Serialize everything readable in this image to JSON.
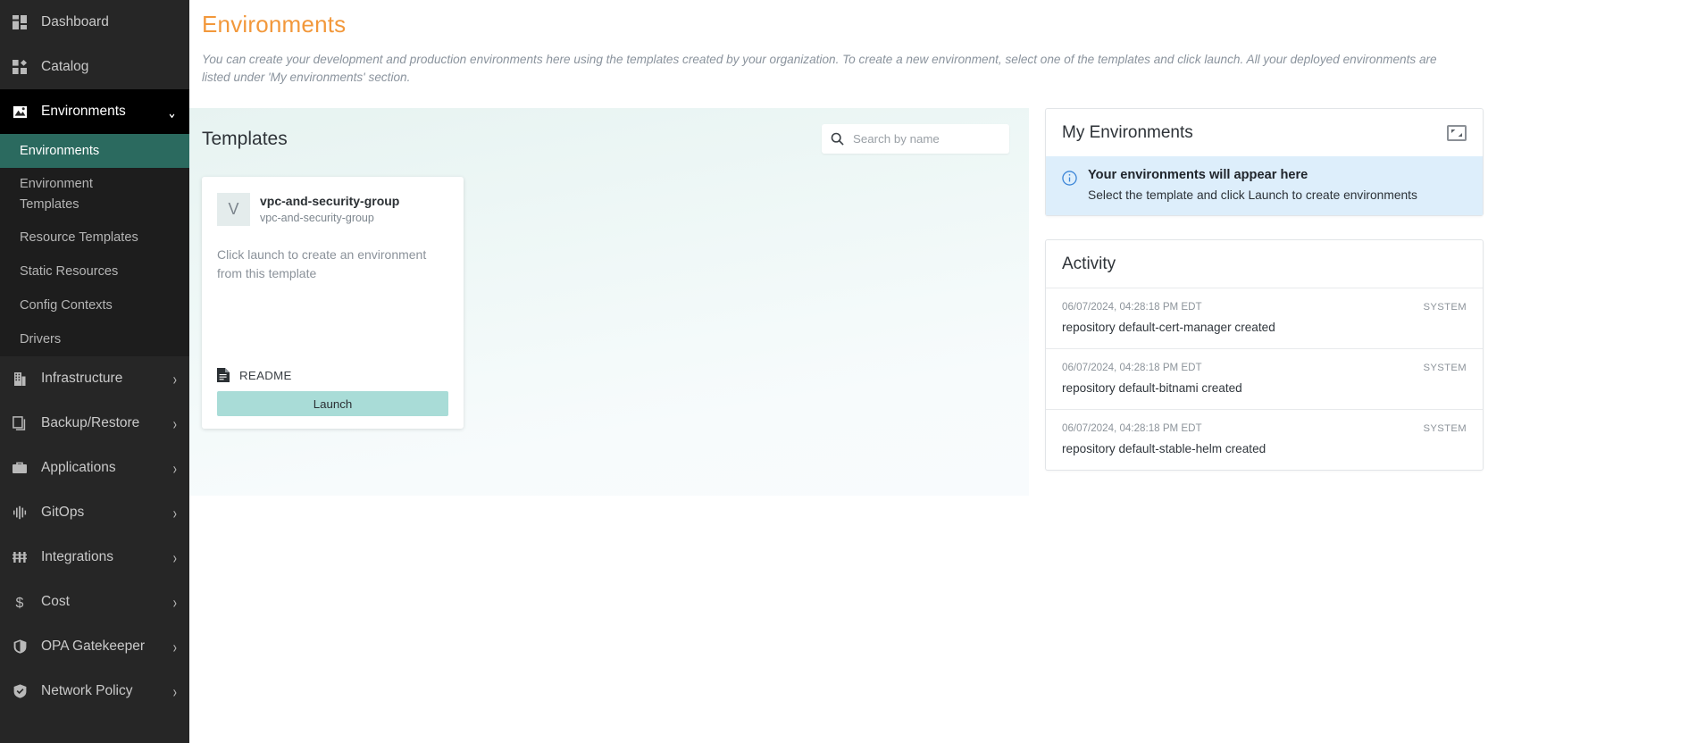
{
  "sidebar": {
    "items": [
      {
        "label": "Dashboard",
        "icon": "dashboard-icon",
        "type": "link"
      },
      {
        "label": "Catalog",
        "icon": "catalog-icon",
        "type": "link"
      },
      {
        "label": "Environments",
        "icon": "environments-icon",
        "type": "group",
        "expanded": true,
        "chevron": "⌄"
      },
      {
        "label": "Infrastructure",
        "icon": "infrastructure-icon",
        "type": "group",
        "chevron": "›"
      },
      {
        "label": "Backup/Restore",
        "icon": "backup-restore-icon",
        "type": "group",
        "chevron": "›"
      },
      {
        "label": "Applications",
        "icon": "applications-icon",
        "type": "group",
        "chevron": "›"
      },
      {
        "label": "GitOps",
        "icon": "gitops-icon",
        "type": "group",
        "chevron": "›"
      },
      {
        "label": "Integrations",
        "icon": "integrations-icon",
        "type": "group",
        "chevron": "›"
      },
      {
        "label": "Cost",
        "icon": "cost-icon",
        "type": "group",
        "chevron": "›"
      },
      {
        "label": "OPA Gatekeeper",
        "icon": "opa-gatekeeper-icon",
        "type": "group",
        "chevron": "›"
      },
      {
        "label": "Network Policy",
        "icon": "network-policy-icon",
        "type": "group",
        "chevron": "›"
      }
    ],
    "environments_submenu": [
      {
        "label": "Environments",
        "active": true
      },
      {
        "label": "Environment Templates",
        "active": false
      },
      {
        "label": "Resource Templates",
        "active": false
      },
      {
        "label": "Static Resources",
        "active": false
      },
      {
        "label": "Config Contexts",
        "active": false
      },
      {
        "label": "Drivers",
        "active": false
      }
    ]
  },
  "page": {
    "title": "Environments",
    "description": "You can create your development and production environments here using the templates created by your organization. To create a new environment, select one of the templates and click launch. All your deployed environments are listed under 'My environments' section."
  },
  "templates": {
    "heading": "Templates",
    "search_placeholder": "Search by name",
    "search_value": "",
    "cards": [
      {
        "avatar_letter": "V",
        "name": "vpc-and-security-group",
        "subtitle": "vpc-and-security-group",
        "body": "Click launch to create an environment from this template",
        "readme_label": "README",
        "launch_label": "Launch"
      }
    ]
  },
  "my_environments": {
    "title": "My Environments",
    "expand_icon": "expand-icon",
    "empty_title": "Your environments will appear here",
    "empty_subtitle": "Select the template and click Launch to create environments"
  },
  "activity": {
    "title": "Activity",
    "rows": [
      {
        "time": "06/07/2024, 04:28:18 PM EDT",
        "source": "SYSTEM",
        "message": "repository default-cert-manager created"
      },
      {
        "time": "06/07/2024, 04:28:18 PM EDT",
        "source": "SYSTEM",
        "message": "repository default-bitnami created"
      },
      {
        "time": "06/07/2024, 04:28:18 PM EDT",
        "source": "SYSTEM",
        "message": "repository default-stable-helm created"
      }
    ]
  },
  "colors": {
    "accent_orange": "#f2983b",
    "sidebar_bg": "#262626",
    "sidebar_active": "#2b6a5f",
    "launch_button": "#a9dcd7",
    "info_banner": "#ddeefb"
  }
}
